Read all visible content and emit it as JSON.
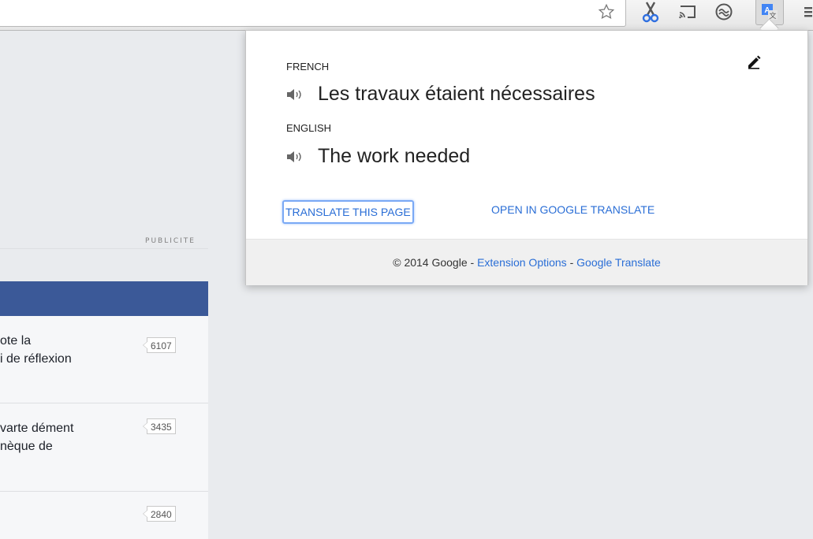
{
  "popup": {
    "source_language": "FRENCH",
    "source_text": "Les travaux étaient nécessaires",
    "target_language": "ENGLISH",
    "target_text": "The work needed",
    "translate_page_label": "TRANSLATE THIS PAGE",
    "open_in_google_translate_label": "OPEN IN GOOGLE TRANSLATE",
    "footer": {
      "copyright": "© 2014 Google - ",
      "extension_options": "Extension Options",
      "separator": " - ",
      "google_translate": "Google Translate"
    }
  },
  "page": {
    "ad_label": "PUBLICITE",
    "news_items": [
      {
        "line1": "ote la",
        "line2": "i de réflexion",
        "count": "6107"
      },
      {
        "line1": "varte dément",
        "line2": "nèque de",
        "count": "3435"
      },
      {
        "line1": "",
        "line2": "",
        "count": "2840"
      }
    ]
  },
  "toolbar": {
    "icons": [
      "star-icon",
      "cut-icon",
      "cast-icon",
      "sync-icon",
      "google-translate-extension-icon",
      "chrome-menu-icon"
    ]
  },
  "colors": {
    "link": "#2a6ed6",
    "facebook_blue": "#3b5998",
    "focus_ring": "#7aa9f5"
  }
}
